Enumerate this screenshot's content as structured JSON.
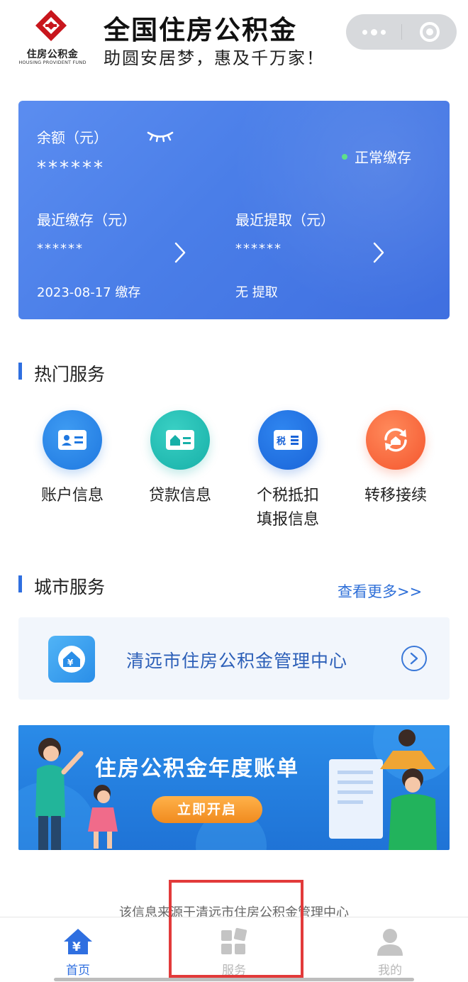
{
  "header": {
    "logo_text": "住房公积金",
    "logo_subtext": "HOUSING PROVIDENT FUND",
    "title": "全国住房公积金",
    "slogan": "助圆安居梦，惠及千万家！"
  },
  "balance_card": {
    "balance_label": "余额（元）",
    "balance_value": "******",
    "status": "正常缴存",
    "recent_deposit_label": "最近缴存（元）",
    "recent_deposit_value": "******",
    "recent_deposit_note": "2023-08-17 缴存",
    "recent_withdraw_label": "最近提取（元）",
    "recent_withdraw_value": "******",
    "recent_withdraw_note": "无 提取"
  },
  "hot_services": {
    "title": "热门服务",
    "items": [
      {
        "label": "账户信息",
        "icon": "account-card-icon"
      },
      {
        "label": "贷款信息",
        "icon": "loan-card-icon"
      },
      {
        "label": "个税抵扣\n填报信息",
        "icon": "tax-card-icon"
      },
      {
        "label": "转移接续",
        "icon": "transfer-icon"
      }
    ]
  },
  "city_services": {
    "title": "城市服务",
    "more_label": "查看更多>>",
    "center_name": "清远市住房公积金管理中心"
  },
  "banner": {
    "title": "住房公积金年度账单",
    "button_label": "立即开启"
  },
  "source_note": "该信息来源于清远市住房公积金管理中心",
  "tabbar": {
    "items": [
      {
        "label": "首页",
        "icon": "home-yuan-icon",
        "active": true
      },
      {
        "label": "服务",
        "icon": "services-grid-icon",
        "active": false
      },
      {
        "label": "我的",
        "icon": "user-icon",
        "active": false
      }
    ]
  },
  "colors": {
    "accent": "#2f6fe0",
    "card_gradient_start": "#5b8df0",
    "card_gradient_end": "#3f6fe0",
    "status_dot": "#5ee08a",
    "highlight_box": "#e23a3a"
  }
}
